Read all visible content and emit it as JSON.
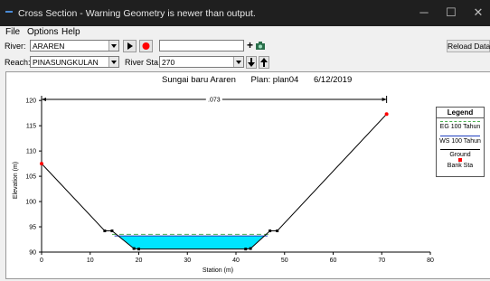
{
  "window": {
    "title": "Cross Section - Warning Geometry is newer than output.",
    "minimize": "─",
    "maximize": "☐",
    "close": "✕"
  },
  "menu": {
    "file": "File",
    "options": "Options",
    "help": "Help"
  },
  "toolbar": {
    "river_label": "River:",
    "river_value": "ARAREN",
    "reach_label": "Reach:",
    "reach_value": "PINASUNGKULAN",
    "river_sta_label": "River Sta.:",
    "river_sta_value": "270",
    "plus_label": "+",
    "reload_label": "Reload Data"
  },
  "plot": {
    "title": "Sungai baru Araren",
    "plan": "Plan: plan04",
    "date": "6/12/2019",
    "colors": {
      "ground": "#000000",
      "water": "#00e5ff",
      "eg_line": "#4caf50",
      "ws_line": "#1f3fbf",
      "bank": "#ff0000"
    }
  },
  "legend": {
    "title": "Legend",
    "eg": "EG 100 Tahun",
    "ws": "WS 100 Tahun",
    "ground": "Ground",
    "bank": "Bank Sta"
  },
  "chart_data": {
    "type": "line",
    "title": "Sungai baru Araren",
    "xlabel": "Station (m)",
    "ylabel": "Elevation (m)",
    "xlim": [
      0,
      80
    ],
    "ylim": [
      90,
      122
    ],
    "x_ticks": [
      0,
      10,
      20,
      30,
      40,
      50,
      60,
      70,
      80
    ],
    "y_ticks": [
      90,
      95,
      100,
      105,
      110,
      115,
      120
    ],
    "annotation": ".073",
    "manning_span": [
      0,
      71
    ],
    "series": [
      {
        "name": "Ground",
        "x": [
          0,
          13,
          14.5,
          19,
          20,
          42,
          43,
          47,
          48.5,
          71
        ],
        "y": [
          107.5,
          94.2,
          94.2,
          90.7,
          90.6,
          90.6,
          90.7,
          94.2,
          94.2,
          117.3
        ]
      },
      {
        "name": "EG 100 Tahun",
        "elevation": 93.5,
        "x_range": [
          14.5,
          47
        ]
      },
      {
        "name": "WS 100 Tahun",
        "elevation": 93.2,
        "x_range": [
          15,
          46.5
        ]
      },
      {
        "name": "Bank Sta",
        "x": [
          0,
          71
        ],
        "y": [
          107.5,
          117.3
        ]
      }
    ],
    "grid": false,
    "legend_position": "right"
  }
}
